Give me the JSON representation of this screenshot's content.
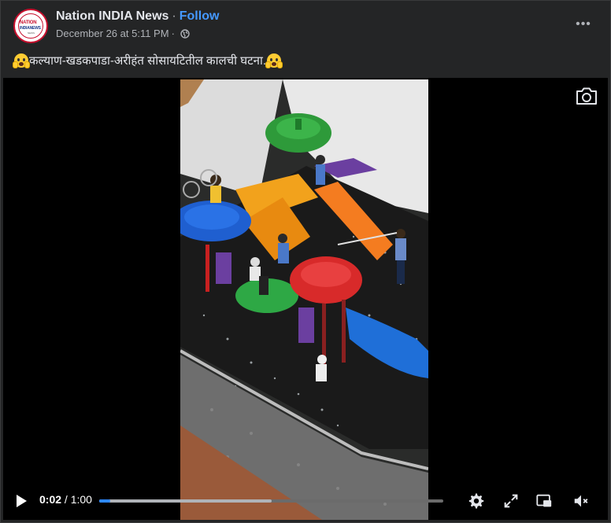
{
  "post": {
    "page_name": "Nation INDIA News",
    "separator": "·",
    "follow_label": "Follow",
    "date": "December 26 at 5:11 PM",
    "date_separator": "·",
    "audience_icon": "globe-icon",
    "more_icon": "more-options-icon",
    "more_label": "•••",
    "caption": "कल्याण-खडकपाडा-अरीहंत सोसायटितील कालची घटना.",
    "caption_emoji": "face-screaming-in-fear"
  },
  "avatar": {
    "logo_line1": "NATION",
    "logo_line2": "INDIANEWS",
    "logo_line3": "NEWS"
  },
  "video": {
    "current_time": "0:02",
    "time_separator": " / ",
    "duration": "1:00",
    "progress": 0.033,
    "buffered": 0.5,
    "icons": {
      "snapshot": "camera-icon",
      "play": "play-icon",
      "settings": "gear-icon",
      "fullscreen": "expand-icon",
      "pip": "picture-in-picture-icon",
      "volume": "muted-speaker-icon"
    }
  },
  "colors": {
    "accent": "#2d88ff",
    "follow": "#4599ff",
    "card_bg": "#242526",
    "page_bg": "#18191a"
  }
}
